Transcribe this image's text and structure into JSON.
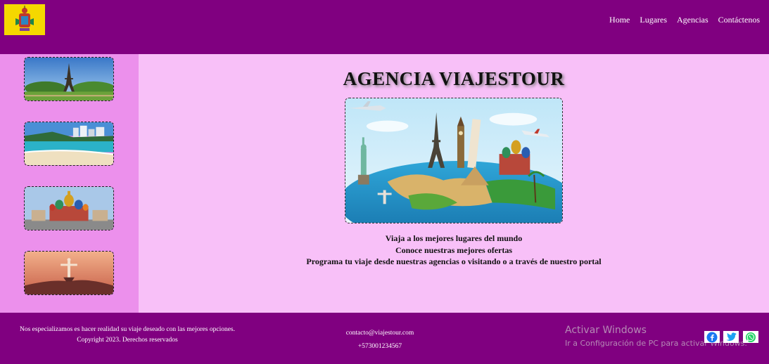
{
  "header": {
    "logo_icon": "coat-of-arms-logo-icon",
    "nav": [
      {
        "label": "Home"
      },
      {
        "label": "Lugares"
      },
      {
        "label": "Agencias"
      },
      {
        "label": "Contáctenos"
      }
    ]
  },
  "sidebar": {
    "thumbnails": [
      {
        "icon": "eiffel-tower-image"
      },
      {
        "icon": "beach-image"
      },
      {
        "icon": "kremlin-cathedral-image"
      },
      {
        "icon": "christ-redeemer-image"
      }
    ]
  },
  "main": {
    "title": "AGENCIA VIAJESTOUR",
    "hero_icon": "world-landmarks-image",
    "lines": [
      "Viaja a los mejores lugares del mundo",
      "Conoce nuestras mejores ofertas",
      "Programa tu viaje desde nuestras agencias o visitando o a través de nuestro portal"
    ]
  },
  "footer": {
    "about_line1": "Nos especializamos es hacer realidad su viaje deseado con las mejores opciones.",
    "about_line2": "Copyright 2023. Derechos reservados",
    "email": "contacto@viajestour.com",
    "phone": "+573001234567",
    "windows_title": "Activar Windows",
    "windows_sub": "Ir a Configuración de PC para activar Windows.",
    "social": [
      "facebook-icon",
      "twitter-icon",
      "whatsapp-icon"
    ]
  },
  "colors": {
    "header_bg": "#800080",
    "sidebar_bg": "#ec90ec",
    "main_bg": "#f8c0f8",
    "logo_bg": "#f5d800"
  }
}
